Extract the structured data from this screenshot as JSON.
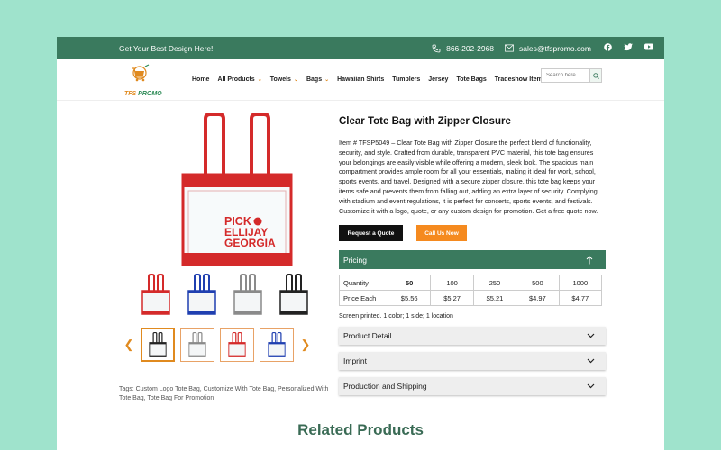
{
  "topbar": {
    "tagline": "Get Your Best Design Here!",
    "phone": "866-202-2968",
    "email": "sales@tfspromo.com",
    "social": [
      "facebook-icon",
      "twitter-icon",
      "youtube-icon"
    ]
  },
  "logo": {
    "text_a": "TFS",
    "text_b": " PROMO"
  },
  "nav": {
    "items": [
      {
        "label": "Home",
        "dropdown": false
      },
      {
        "label": "All Products",
        "dropdown": true
      },
      {
        "label": "Towels",
        "dropdown": true
      },
      {
        "label": "Bags",
        "dropdown": true
      },
      {
        "label": "Hawaiian Shirts",
        "dropdown": false
      },
      {
        "label": "Tumblers",
        "dropdown": false
      },
      {
        "label": "Jersey",
        "dropdown": false
      },
      {
        "label": "Tote Bags",
        "dropdown": false
      },
      {
        "label": "Tradeshow Items",
        "dropdown": false
      }
    ],
    "search_placeholder": "Search here..."
  },
  "product": {
    "title": "Clear Tote Bag with Zipper Closure",
    "description": "Item # TFSP5049 – Clear Tote Bag with Zipper Closure the perfect blend of functionality, security, and style. Crafted from durable, transparent PVC material, this tote bag ensures your belongings are easily visible while offering a modern, sleek look. The spacious main compartment provides ample room for all your essentials, making it ideal for work, school, sports events, and travel. Designed with a secure zipper closure, this tote bag keeps your items safe and prevents them from falling out, adding an extra layer of security. Complying with stadium and event regulations, it is perfect for concerts, sports events, and festivals. Customize it with a logo, quote, or any custom design for promotion. Get a free quote now.",
    "bag_print": [
      "PICK",
      "ELLIJAY",
      "GEORGIA"
    ],
    "request_quote": "Request a Quote",
    "call_us": "Call Us Now",
    "pricing_label": "Pricing",
    "quantity_label": "Quantity",
    "price_label": "Price Each",
    "quantities": [
      "50",
      "100",
      "250",
      "500",
      "1000"
    ],
    "prices": [
      "$5.56",
      "$5.27",
      "$5.21",
      "$4.97",
      "$4.77"
    ],
    "note": "Screen printed. 1 color; 1 side; 1 location",
    "accordions": [
      "Product Detail",
      "Imprint",
      "Production and Shipping"
    ],
    "tags": "Tags: Custom Logo Tote Bag, Customize With Tote Bag, Personalized With Tote Bag, Tote Bag For Promotion",
    "colors": [
      "#d42a2a",
      "#1f3fb0",
      "#8a8a8a",
      "#222222"
    ],
    "carousel_colors": [
      "#222222",
      "#8a8a8a",
      "#d42a2a",
      "#1f3fb0"
    ]
  },
  "related_title": "Related Products"
}
